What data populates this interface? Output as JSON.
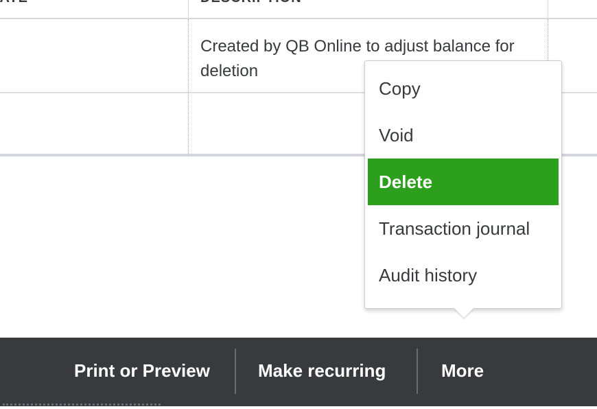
{
  "table": {
    "header_left": "DATE",
    "header_description": "DESCRIPTION",
    "rows": [
      {
        "description": "Created by QB Online to adjust balance for deletion"
      },
      {
        "description": ""
      }
    ]
  },
  "menu": {
    "items": [
      {
        "label": "Copy",
        "active": false
      },
      {
        "label": "Void",
        "active": false
      },
      {
        "label": "Delete",
        "active": true
      },
      {
        "label": "Transaction journal",
        "active": false
      },
      {
        "label": "Audit history",
        "active": false
      }
    ],
    "active_color": "#2ca01c"
  },
  "action_bar": {
    "print_label": "Print or Preview",
    "recurring_label": "Make recurring",
    "more_label": "More",
    "background_color": "#393a3d"
  }
}
